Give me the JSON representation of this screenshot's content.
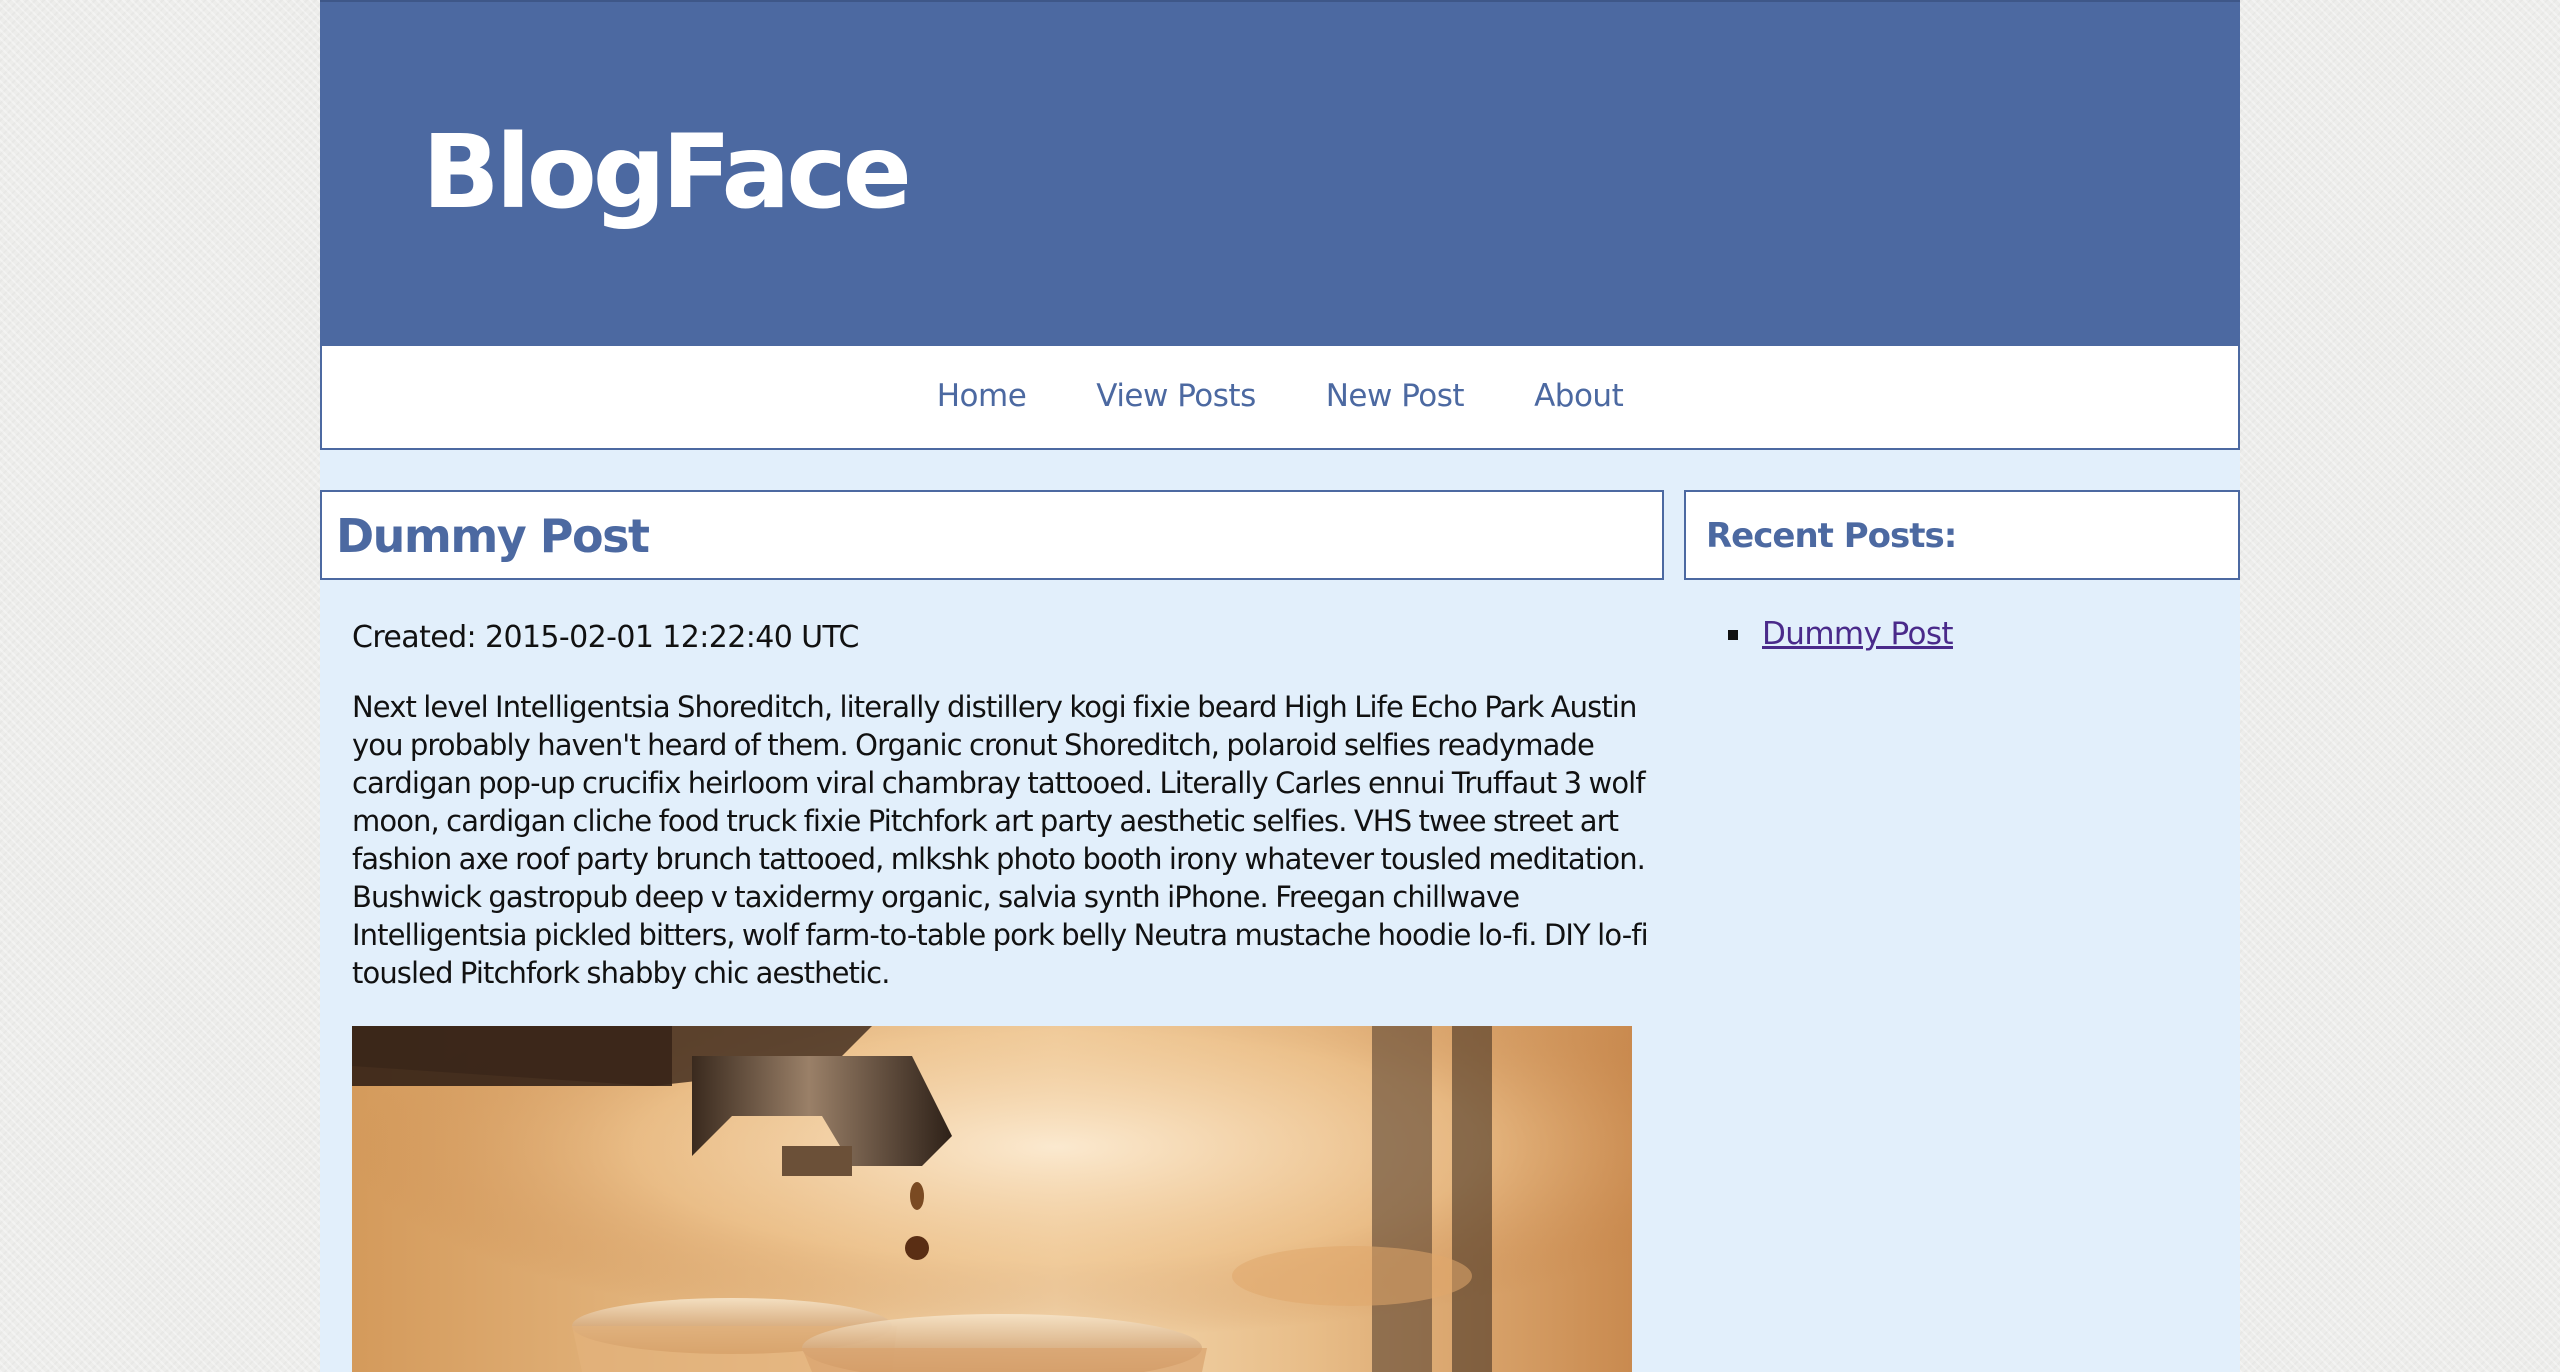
{
  "site": {
    "brand": "BlogFace"
  },
  "nav": {
    "items": [
      "Home",
      "View Posts",
      "New Post",
      "About"
    ]
  },
  "post": {
    "title": "Dummy Post",
    "created": "Created: 2015-02-01 12:22:40 UTC",
    "body": "Next level Intelligentsia Shoreditch, literally distillery kogi fixie beard High Life Echo Park Austin you probably haven't heard of them. Organic cronut Shoreditch, polaroid selfies readymade cardigan pop-up crucifix heirloom viral chambray tattooed. Literally Carles ennui Truffaut 3 wolf moon, cardigan cliche food truck fixie Pitchfork art party aesthetic selfies. VHS twee street art fashion axe roof party brunch tattooed, mlkshk photo booth irony whatever tousled meditation. Bushwick gastropub deep v taxidermy organic, salvia synth iPhone. Freegan chillwave Intelligentsia pickled bitters, wolf farm-to-table pork belly Neutra mustache hoodie lo-fi. DIY lo-fi tousled Pitchfork shabby chic aesthetic."
  },
  "sidebar": {
    "title": "Recent Posts:",
    "recent_posts": [
      "Dummy Post"
    ]
  },
  "colors": {
    "primary": "#4c69a1",
    "page_background": "#e2effb",
    "link_visited": "#4a2a8a"
  }
}
